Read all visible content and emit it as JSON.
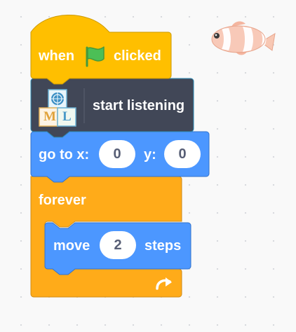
{
  "hat_block": {
    "when": "when",
    "clicked": "clicked",
    "icon": "green-flag-icon",
    "color": "#FFBF00"
  },
  "ml_block": {
    "label": "start listening",
    "icon": "ml-extension-icon",
    "icon_letters": [
      "M",
      "L"
    ],
    "color": "#414757"
  },
  "goto_block": {
    "label": "go to x:",
    "y_label": "y:",
    "x_value": "0",
    "y_value": "0",
    "color": "#4C97FF"
  },
  "forever_block": {
    "label": "forever",
    "loop_icon": "loop-arrow-icon",
    "color": "#FFAB19"
  },
  "move_block": {
    "label": "move",
    "steps_value": "2",
    "steps_label": "steps",
    "color": "#4C97FF"
  },
  "sprite": {
    "icon": "clownfish-sprite-icon"
  }
}
